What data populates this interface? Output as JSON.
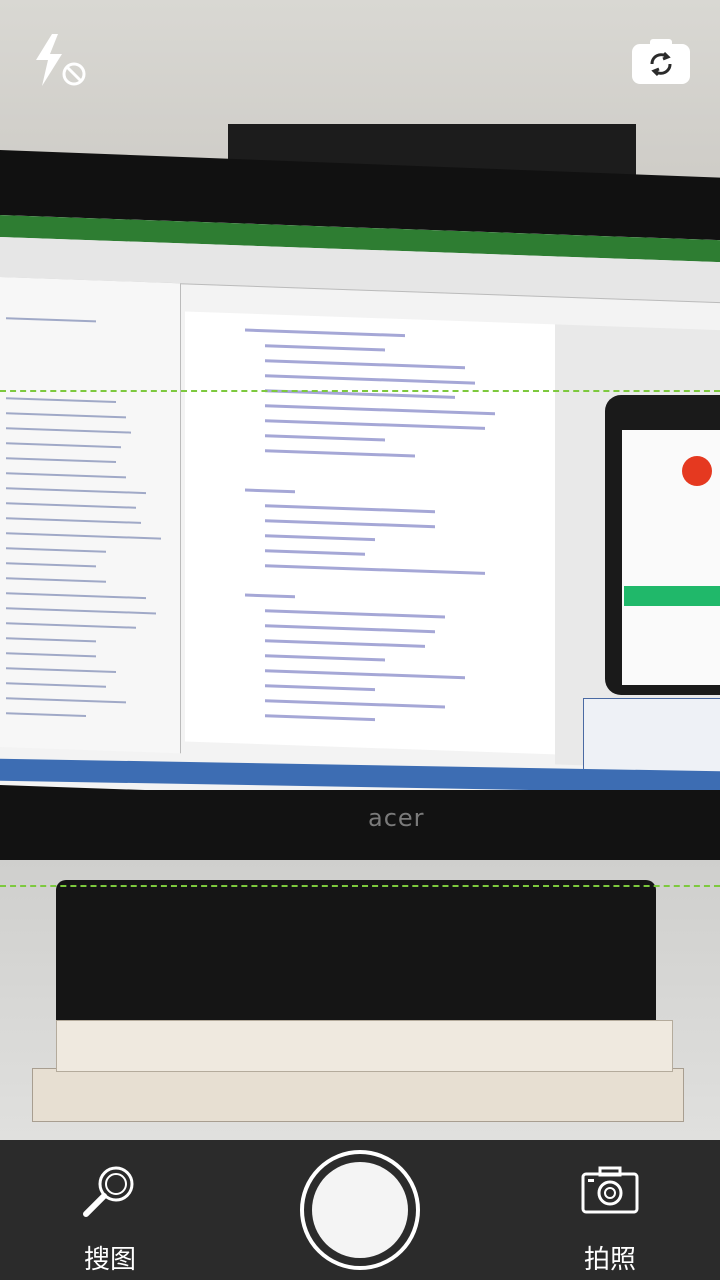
{
  "top_controls": {
    "flash_icon": "flash-off-icon",
    "switch_icon": "switch-camera-icon"
  },
  "viewfinder": {
    "monitor_brand": "acer"
  },
  "bottom_bar": {
    "search_label": "搜图",
    "photo_label": "拍照",
    "search_icon": "magnifier-icon",
    "photo_icon": "camera-icon",
    "shutter_icon": "shutter-icon"
  },
  "colors": {
    "scan_line": "#7dc93e",
    "bar_bg": "#2b2b2b",
    "text": "#ffffff"
  }
}
